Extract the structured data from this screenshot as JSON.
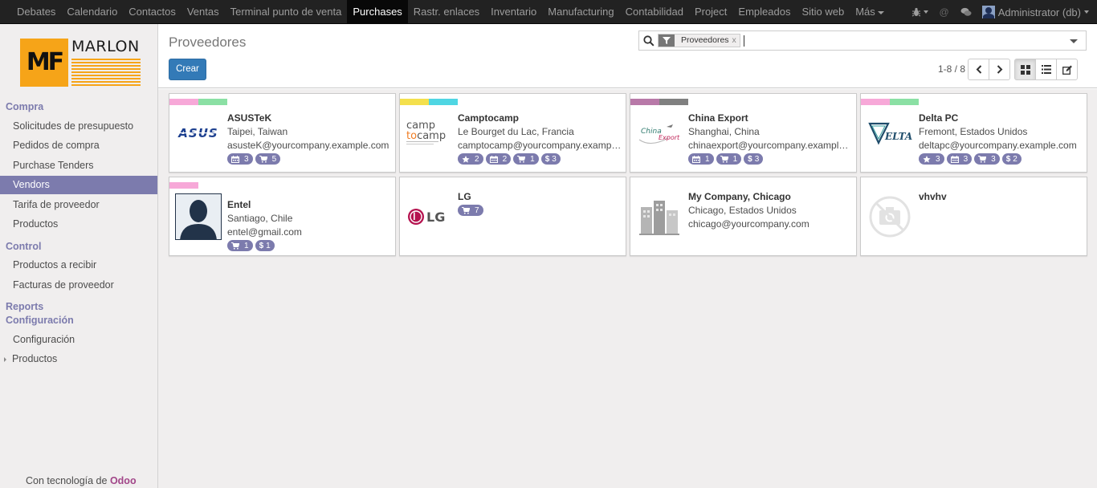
{
  "topnav": {
    "items": [
      "Debates",
      "Calendario",
      "Contactos",
      "Ventas",
      "Terminal punto de venta",
      "Purchases",
      "Rastr. enlaces",
      "Inventario",
      "Manufacturing",
      "Contabilidad",
      "Project",
      "Empleados",
      "Sitio web",
      "Más"
    ],
    "active": "Purchases",
    "user_label": "Administrator (db)"
  },
  "logo": {
    "initials": "MF",
    "name": "MARLON"
  },
  "sidebar": {
    "section_compra": "Compra",
    "compra_items": [
      "Solicitudes de presupuesto",
      "Pedidos de compra",
      "Purchase Tenders",
      "Vendors",
      "Tarifa de proveedor",
      "Productos"
    ],
    "section_control": "Control",
    "control_items": [
      "Productos a recibir",
      "Facturas de proveedor"
    ],
    "section_reports": "Reports",
    "section_config": "Configuración",
    "config_items": [
      "Configuración",
      "Productos"
    ],
    "powered_prefix": "Con tecnología de ",
    "powered_brand": "Odoo"
  },
  "controlpanel": {
    "title": "Proveedores",
    "create_label": "Crear",
    "facet_value": "Proveedores",
    "facet_remove": "x",
    "pager": "1-8 / 8"
  },
  "cards": [
    {
      "name": "ASUSTeK",
      "line1": "Taipei, Taiwan",
      "line2": "asusteK@yourcompany.example.com",
      "tag_colors": [
        "#f7a8d8",
        "#8be0a4"
      ],
      "logo": "asus-logo",
      "badges": [
        {
          "icon": "calendar-icon",
          "value": "3"
        },
        {
          "icon": "cart-icon",
          "value": "5"
        }
      ]
    },
    {
      "name": "Camptocamp",
      "line1": "Le Bourget du Lac, Francia",
      "line2": "camptocamp@yourcompany.example.com",
      "tag_colors": [
        "#f4e04d",
        "#4fd6e3"
      ],
      "logo": "camptocamp-logo",
      "badges": [
        {
          "icon": "star-icon",
          "value": "2"
        },
        {
          "icon": "calendar-icon",
          "value": "2"
        },
        {
          "icon": "cart-icon",
          "value": "1"
        },
        {
          "icon": "dollar-icon",
          "value": "3"
        }
      ]
    },
    {
      "name": "China Export",
      "line1": "Shanghai, China",
      "line2": "chinaexport@yourcompany.example.com",
      "tag_colors": [
        "#b879a8",
        "#808080"
      ],
      "logo": "china-export-logo",
      "badges": [
        {
          "icon": "calendar-icon",
          "value": "1"
        },
        {
          "icon": "cart-icon",
          "value": "1"
        },
        {
          "icon": "dollar-icon",
          "value": "3"
        }
      ]
    },
    {
      "name": "Delta PC",
      "line1": "Fremont, Estados Unidos",
      "line2": "deltapc@yourcompany.example.com",
      "tag_colors": [
        "#f7a8d8",
        "#8be0a4"
      ],
      "logo": "delta-pc-logo",
      "badges": [
        {
          "icon": "star-icon",
          "value": "3"
        },
        {
          "icon": "calendar-icon",
          "value": "3"
        },
        {
          "icon": "cart-icon",
          "value": "3"
        },
        {
          "icon": "dollar-icon",
          "value": "2"
        }
      ]
    },
    {
      "name": "Entel",
      "line1": "Santiago, Chile",
      "line2": "entel@gmail.com",
      "tag_colors": [
        "#f7a8d8"
      ],
      "logo": "person-avatar",
      "badges": [
        {
          "icon": "cart-icon",
          "value": "1"
        },
        {
          "icon": "dollar-icon",
          "value": "1"
        }
      ]
    },
    {
      "name": "LG",
      "line1": "",
      "line2": "",
      "tag_colors": [],
      "logo": "lg-logo",
      "badges": [
        {
          "icon": "cart-icon",
          "value": "7"
        }
      ]
    },
    {
      "name": "My Company, Chicago",
      "line1": "Chicago, Estados Unidos",
      "line2": "chicago@yourcompany.com",
      "tag_colors": [],
      "logo": "buildings-icon",
      "badges": []
    },
    {
      "name": "vhvhv",
      "line1": "",
      "line2": "",
      "tag_colors": [],
      "logo": "no-image-icon",
      "badges": []
    }
  ]
}
